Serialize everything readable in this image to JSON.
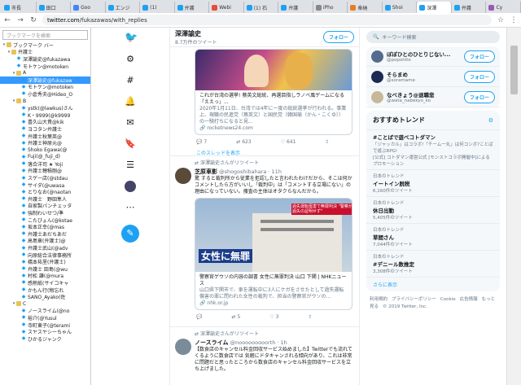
{
  "browser": {
    "tabs": [
      {
        "label": "市長",
        "color": "#1da1f2"
      },
      {
        "label": "田口",
        "color": "#1da1f2"
      },
      {
        "label": "Goo",
        "color": "#4285f4"
      },
      {
        "label": "エンジ",
        "color": "#1da1f2"
      },
      {
        "label": "(1)",
        "color": "#1da1f2"
      },
      {
        "label": "弁護",
        "color": "#1da1f2"
      },
      {
        "label": "Webi",
        "color": "#e74c3c"
      },
      {
        "label": "(1) 石",
        "color": "#1da1f2"
      },
      {
        "label": "弁護",
        "color": "#1da1f2"
      },
      {
        "label": "iPho",
        "color": "#888888"
      },
      {
        "label": "奉納",
        "color": "#e67e22"
      },
      {
        "label": "Shoi",
        "color": "#1da1f2"
      },
      {
        "label": "深澤",
        "color": "#1da1f2"
      },
      {
        "label": "弁護",
        "color": "#1da1f2"
      },
      {
        "label": "Cy",
        "color": "#9b59b6"
      }
    ],
    "active_tab": 12,
    "url_host": "twitter.com",
    "url_path": "/fukazawas/with_replies"
  },
  "bookmarks": {
    "search_placeholder": "ブックマークを検索",
    "items": [
      {
        "label": "ブックマーク バー",
        "level": 0,
        "type": "folder",
        "toggle": "▾"
      },
      {
        "label": "弁護士",
        "level": 1,
        "type": "folder",
        "toggle": "▾"
      },
      {
        "label": "深澤諭史@fukazawa",
        "level": 2,
        "type": "tw"
      },
      {
        "label": "モトケン@motoken_",
        "level": 2,
        "type": "tw"
      },
      {
        "label": "A",
        "level": 2,
        "type": "folder",
        "toggle": "▾"
      },
      {
        "label": "深澤諭史@fukazaw",
        "level": 3,
        "type": "tw",
        "selected": true
      },
      {
        "label": "モトケン@motoken",
        "level": 3,
        "type": "tw"
      },
      {
        "label": "小倉秀夫@Hideo_O",
        "level": 3,
        "type": "tw"
      },
      {
        "label": "B",
        "level": 2,
        "type": "folder",
        "toggle": "▾"
      },
      {
        "label": "ystk(@lawkus)さん",
        "level": 3,
        "type": "tw"
      },
      {
        "label": "K・9999(@k9999",
        "level": 3,
        "type": "tw"
      },
      {
        "label": "喜久山大貴@kik",
        "level": 3,
        "type": "tw"
      },
      {
        "label": "ヨコタン弁護士",
        "level": 3,
        "type": "tw"
      },
      {
        "label": "弁護士秋葉英@",
        "level": 3,
        "type": "tw"
      },
      {
        "label": "弁護士神原元@",
        "level": 3,
        "type": "tw"
      },
      {
        "label": "Shoko Egawa(@",
        "level": 3,
        "type": "tw"
      },
      {
        "label": "Fuji(@_fuji_d)",
        "level": 3,
        "type": "tw"
      },
      {
        "label": "落合洋司 ★ Yoji",
        "level": 3,
        "type": "tw"
      },
      {
        "label": "弁護士穂積剛@",
        "level": 3,
        "type": "tw"
      },
      {
        "label": "スゲー店(@stdau",
        "level": 3,
        "type": "tw"
      },
      {
        "label": "サイダ(@uwasa",
        "level": 3,
        "type": "tw"
      },
      {
        "label": "とりなお(@naotan",
        "level": 3,
        "type": "tw"
      },
      {
        "label": "弁護士　野田隼人",
        "level": 3,
        "type": "tw"
      },
      {
        "label": "自家製パンチェッタ",
        "level": 3,
        "type": "tw"
      },
      {
        "label": "強制わいせつ/準",
        "level": 3,
        "type": "tw"
      },
      {
        "label": "こたびょん(@kotae",
        "level": 3,
        "type": "tw"
      },
      {
        "label": "坂本正幸(@mas",
        "level": 3,
        "type": "tw"
      },
      {
        "label": "弁護士あだちあだ",
        "level": 3,
        "type": "tw"
      },
      {
        "label": "高島章(弁護士)@",
        "level": 3,
        "type": "tw"
      },
      {
        "label": "弁護士武山(@adv",
        "level": 3,
        "type": "tw"
      },
      {
        "label": "向原総合法律事務所",
        "level": 3,
        "type": "tw"
      },
      {
        "label": "橋本祐里(弁護士)",
        "level": 3,
        "type": "tw"
      },
      {
        "label": "弁護士 田島(@wu",
        "level": 3,
        "type": "tw"
      },
      {
        "label": "村松 謙(@mura",
        "level": 3,
        "type": "tw"
      },
      {
        "label": "感熱紙(サイコキャ",
        "level": 3,
        "type": "tw"
      },
      {
        "label": "かもん行(物忘れ",
        "level": 3,
        "type": "tw"
      },
      {
        "label": "SANO_Ayako(佐",
        "level": 3,
        "type": "tw"
      },
      {
        "label": "C",
        "level": 2,
        "type": "folder",
        "toggle": "▾"
      },
      {
        "label": "ノースライム(@no",
        "level": 3,
        "type": "tw"
      },
      {
        "label": "裕介(@Yusul",
        "level": 3,
        "type": "tw"
      },
      {
        "label": "寺町東子(@terami",
        "level": 3,
        "type": "tw"
      },
      {
        "label": "スヤスヤシーちゃん",
        "level": 3,
        "type": "tw"
      },
      {
        "label": "ひかるジャンク",
        "level": 3,
        "type": "tw"
      }
    ]
  },
  "profile": {
    "name": "深澤諭史",
    "tweet_count": "8.7万件のツイート",
    "follow_label": "フォロー"
  },
  "tweets": [
    {
      "card_title": "これが台湾の選挙! 蔡英文総統、再選目指しラノベ風ゲームになる『ええっ」...",
      "card_desc": "2020年1月11日、台湾では4年に一度の総統選挙が行われる。事業上、現職の民進党（蔡英文）と国民党（韓国瑜（かん・こくゆ））の一騎打ちになると見...",
      "card_url": "rocketnews24.com",
      "replies": "7",
      "retweets": "623",
      "likes": "641",
      "thread_link": "このスレッドを表示"
    },
    {
      "rt_label": "深澤諭史さんがリツイート",
      "name": "芝原車影",
      "handle": "@shogoshibahara · 11h",
      "text": "驚 すると裁判所から従業を拒認したと言われたわけだから、そこは何かコメントしたら方がいいし「裁判中」は「コメントする立場にない」の理由になっていない。捜査の主体はオタクらなんだから。",
      "image_caption": "女性に無罪",
      "image_headline": "過失運転傷害で無罪判決 \"警察が過失の証明せず\"",
      "card_title": "警察官ゲウソの内容の調書 女性に無罪判決 山口 下関 | NHKニュース",
      "card_desc": "山口県下関市で、車を運転中に3人にケガをさせたとして過失運転傷害の罪に問われた女性の裁判で、担当の警察官がウソの...",
      "card_url": "nhk.or.jp",
      "replies": "",
      "retweets": "5",
      "likes": "3"
    },
    {
      "rt_label": "深澤諭史さんがリツイート",
      "name": "ノースライム",
      "handle": "@nooooooooorth · 1h",
      "text": "【数食店のキャンセル料金回収サービス始めました】Twitterでも流れてくるように数食店では 気軽にドタキャンされる傾向があり、これは非常に問題だと思ったところから数食店のキャンセル料金回収サービスを立ち上げました。"
    }
  ],
  "right": {
    "search_placeholder": "キーワード検索",
    "who_to_follow": [
      {
        "name": "ぽぽひとのひとりじない...",
        "handle": "@popohito",
        "follow": "フォロー",
        "color": "#556b8d"
      },
      {
        "name": "そらまめ",
        "handle": "@soramame",
        "follow": "フォロー",
        "color": "#1a2a55"
      },
      {
        "name": "なべきょう@退職悲",
        "handle": "@wata_nabekyo_ko",
        "follow": "フォロー",
        "color": "#c8b89a"
      }
    ],
    "trends_title": "おすすめトレンド",
    "trends": [
      {
        "meta": "",
        "title": "#ことばで遊べコトダマン",
        "desc": "「ジャッカル」はコラボ!「チーム一丸」は何コンボ?ことばで遊ぶRPG!",
        "promo": "[公式] コトダマン運営公式 [モンストコラボ開催中]によるプロモーション"
      },
      {
        "meta": "日本のトレンド",
        "title": "イートイン脱税",
        "count": "6,160件のツイート"
      },
      {
        "meta": "日本のトレンド",
        "title": "休日出勤",
        "count": "5,405件のツイート"
      },
      {
        "meta": "日本のトレンド",
        "title": "草間さん",
        "count": "7,044件のツイート"
      },
      {
        "meta": "日本のトレンド",
        "title": "#デニール数推定",
        "count": "3,308件のツイート"
      }
    ],
    "show_more": "さらに表示",
    "footer": [
      "利用規約",
      "プライバシーポリシー",
      "Cookie",
      "広告情報",
      "もっと見る",
      "© 2019 Twitter, Inc."
    ]
  }
}
